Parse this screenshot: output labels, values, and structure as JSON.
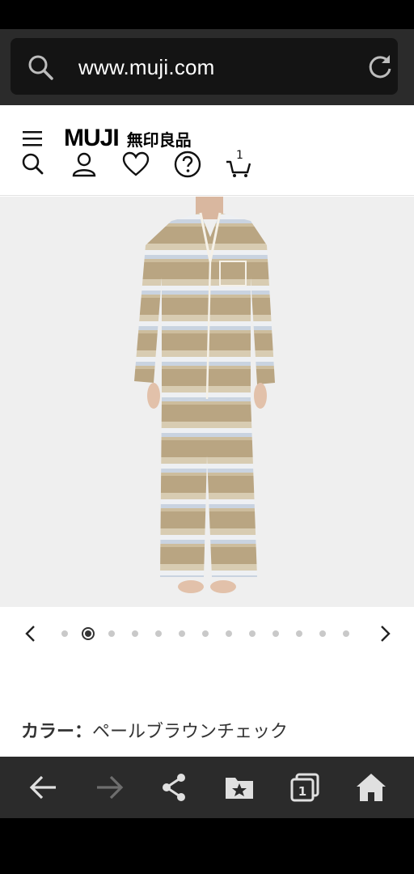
{
  "browser": {
    "url": "www.muji.com"
  },
  "header": {
    "logo_en": "MUJI",
    "logo_jp": "無印良品",
    "cart_count": "1"
  },
  "product": {
    "image_alt": "Pajama set, pale brown check",
    "carousel_total": 13,
    "carousel_active": 2,
    "color_label": "カラー：",
    "color_value": "ペールブラウンチェック"
  },
  "colors": {
    "accent": "#000000",
    "browser_bg": "#2b2b2b",
    "image_bg": "#efefef"
  },
  "bottom_nav": {
    "tab_count": "1"
  }
}
